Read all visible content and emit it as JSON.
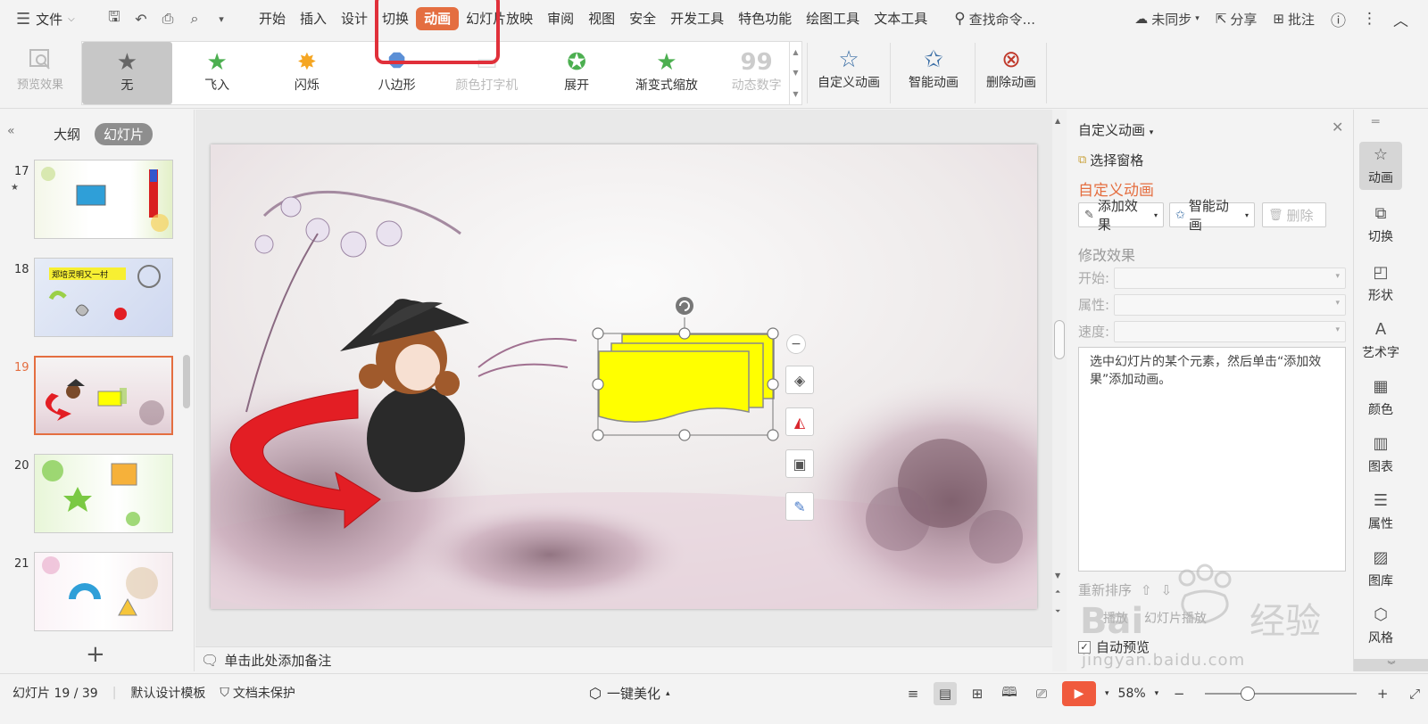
{
  "menubar": {
    "file_label": "文件",
    "tabs": [
      "开始",
      "插入",
      "设计",
      "切换",
      "动画",
      "幻灯片放映",
      "审阅",
      "视图",
      "安全",
      "开发工具",
      "特色功能",
      "绘图工具",
      "文本工具"
    ],
    "active_tab": "动画",
    "search_label": "查找命令...",
    "sync_label": "未同步",
    "share_label": "分享",
    "comment_label": "批注"
  },
  "ribbon": {
    "preview_label": "预览效果",
    "gallery": [
      {
        "label": "无",
        "icon": "star-gray-icon"
      },
      {
        "label": "飞入",
        "icon": "star-fly-icon"
      },
      {
        "label": "闪烁",
        "icon": "star-flash-icon"
      },
      {
        "label": "八边形",
        "icon": "octagon-icon"
      },
      {
        "label": "颜色打字机",
        "icon": "typewriter-icon"
      },
      {
        "label": "展开",
        "icon": "star-expand-icon"
      },
      {
        "label": "渐变式缩放",
        "icon": "star-zoom-icon"
      },
      {
        "label": "动态数字",
        "icon": "number-icon"
      }
    ],
    "custom_anim_label": "自定义动画",
    "smart_anim_label": "智能动画",
    "delete_anim_label": "删除动画"
  },
  "left_panel": {
    "tab_outline": "大纲",
    "tab_slides": "幻灯片",
    "thumbnails": [
      {
        "num": "17"
      },
      {
        "num": "18",
        "caption": "郑培灵明又一村"
      },
      {
        "num": "19"
      },
      {
        "num": "20"
      },
      {
        "num": "21"
      }
    ],
    "add_label": "+"
  },
  "notes_label": "单击此处添加备注",
  "right_panel": {
    "title": "自定义动画",
    "select_pane": "选择窗格",
    "section_title": "自定义动画",
    "add_effect": "添加效果",
    "smart_anim": "智能动画",
    "delete": "删除",
    "modify_title": "修改效果",
    "start_label": "开始:",
    "property_label": "属性:",
    "speed_label": "速度:",
    "hint": "选中幻灯片的某个元素，然后单击“添加效果”添加动画。",
    "reorder": "重新排序",
    "play": "播放",
    "slideshow": "幻灯片播放",
    "auto_preview": "自动预览"
  },
  "sidebar": [
    {
      "label": "动画",
      "icon": "star-icon",
      "active": true
    },
    {
      "label": "切换",
      "icon": "transition-icon"
    },
    {
      "label": "形状",
      "icon": "shape-icon"
    },
    {
      "label": "艺术字",
      "icon": "wordart-icon"
    },
    {
      "label": "颜色",
      "icon": "color-icon"
    },
    {
      "label": "图表",
      "icon": "chart-icon"
    },
    {
      "label": "属性",
      "icon": "property-icon"
    },
    {
      "label": "图库",
      "icon": "gallery-icon"
    },
    {
      "label": "风格",
      "icon": "style-icon"
    }
  ],
  "status": {
    "slide_info": "幻灯片 19 / 39",
    "template": "默认设计模板",
    "protect": "文档未保护",
    "beautify": "一键美化",
    "zoom": "58%"
  },
  "watermark": "jingyan.baidu.com",
  "colors": {
    "accent": "#e46e40",
    "highlight_box": "#e0303a",
    "shape_fill": "#ffff00",
    "arrow": "#e31e24"
  }
}
